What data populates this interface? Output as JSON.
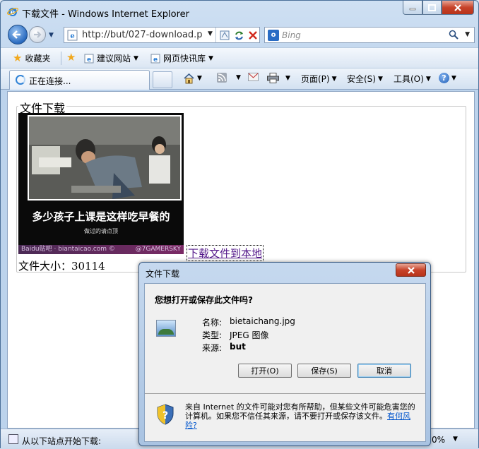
{
  "window": {
    "title": "下载文件 - Windows Internet Explorer"
  },
  "address": {
    "url": "http://but/027-download.p"
  },
  "search": {
    "placeholder": "Bing"
  },
  "favorites": {
    "favorites_label": "收藏夹",
    "items": [
      "建议网站",
      "网页快讯库"
    ]
  },
  "tab": {
    "label": "正在连接..."
  },
  "commands": {
    "page": "页面(P)",
    "safety": "安全(S)",
    "tools": "工具(O)"
  },
  "content": {
    "legend": "文件下载",
    "image_caption": "多少孩子上课是这样吃早餐的",
    "image_subcaption": "做过的请点顶",
    "image_watermark_left": "Baidu贴吧 · biantaicao.com ©",
    "image_watermark_right": "@7GAMERSKY",
    "download_link": "下载文件到本地",
    "file_size": "文件大小：30114"
  },
  "status": {
    "text": "从以下站点开始下载:",
    "zoom": "0%"
  },
  "dialog": {
    "title": "文件下载",
    "question": "您想打开或保存此文件吗?",
    "name_label": "名称:",
    "name_value": "bietaichang.jpg",
    "type_label": "类型:",
    "type_value": "JPEG 图像",
    "source_label": "来源:",
    "source_value": "but",
    "open_button": "打开(O)",
    "save_button": "保存(S)",
    "cancel_button": "取消",
    "warning_text": "来自 Internet 的文件可能对您有所帮助，但某些文件可能危害您的计算机。如果您不信任其来源，请不要打开或保存该文件。",
    "risk_link": "有何风险?"
  }
}
